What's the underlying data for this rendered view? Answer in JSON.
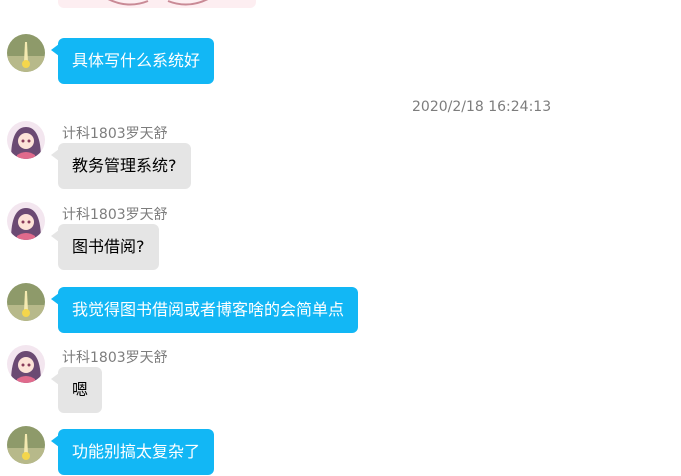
{
  "chat": {
    "timestamp": "2020/2/18 16:24:13",
    "messages": [
      {
        "sender": "self",
        "text": "具体写什么系统好"
      },
      {
        "sender": "other",
        "name": "计科1803罗天舒",
        "text": "教务管理系统?"
      },
      {
        "sender": "other",
        "name": "计科1803罗天舒",
        "text": "图书借阅?"
      },
      {
        "sender": "self",
        "text": "我觉得图书借阅或者博客啥的会简单点"
      },
      {
        "sender": "other",
        "name": "计科1803罗天舒",
        "text": "嗯"
      },
      {
        "sender": "self",
        "text": "功能别搞太复杂了"
      }
    ]
  },
  "colors": {
    "self_bubble": "#12b7f5",
    "other_bubble": "#e5e5e5",
    "meta_text": "#7d7d7d"
  }
}
